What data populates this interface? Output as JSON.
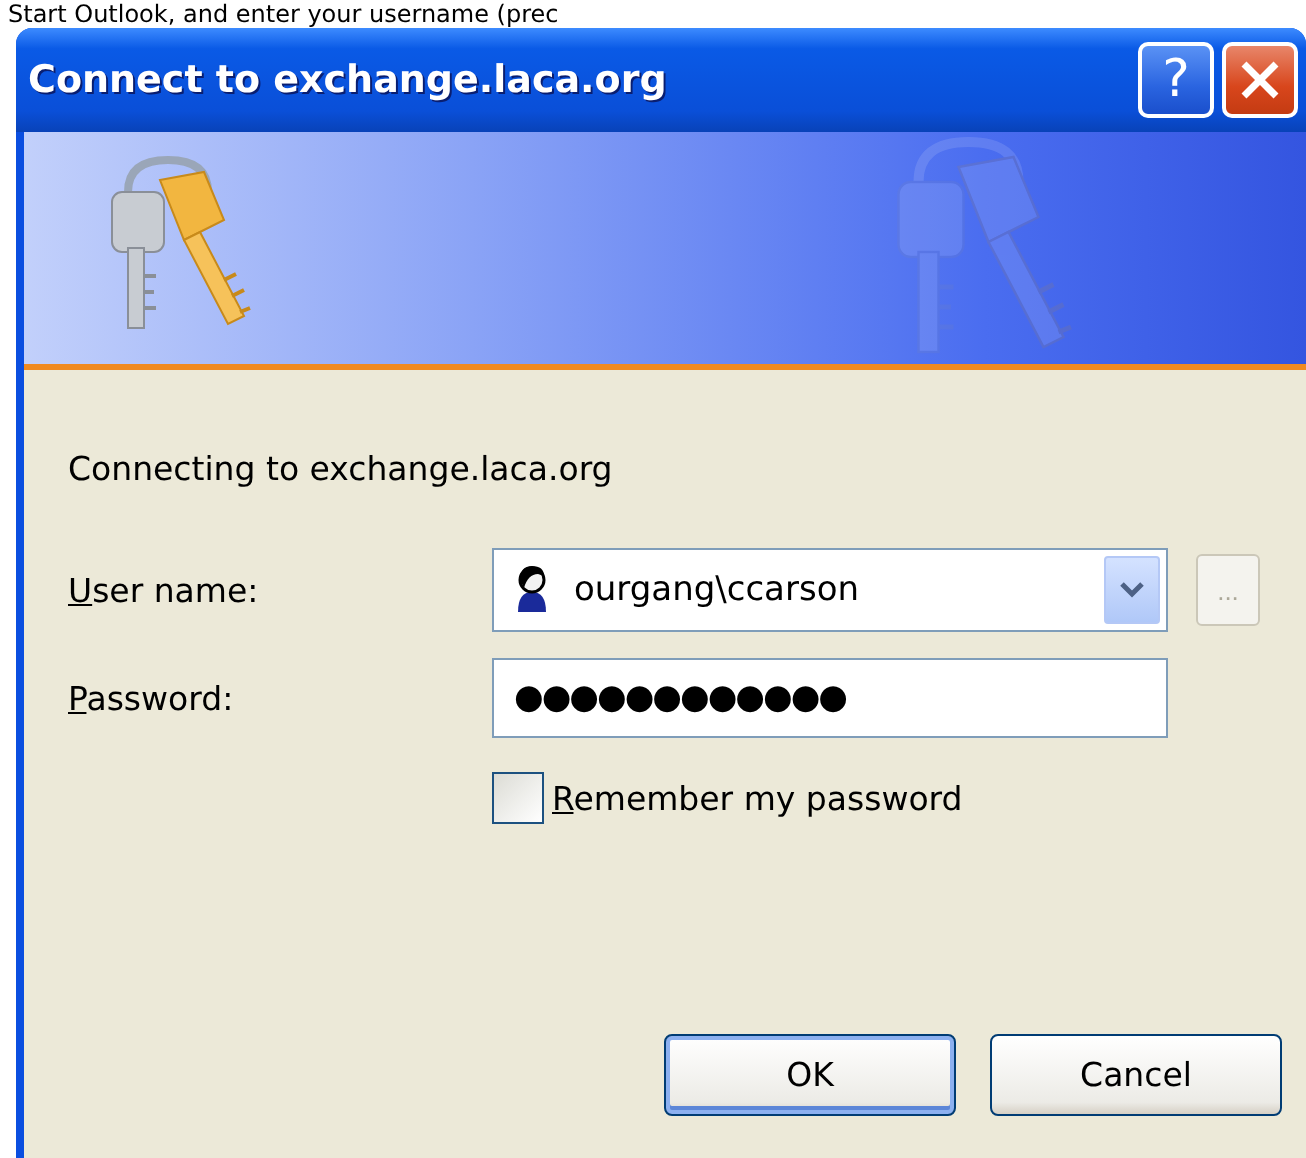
{
  "page_heading": "Start Outlook, and enter your username (prec",
  "window": {
    "title": "Connect to exchange.laca.org",
    "help_label": "?"
  },
  "message": "Connecting to exchange.laca.org",
  "fields": [
    {
      "kind": "combo",
      "label": "User name:",
      "value": "ourgang\\ccarson"
    },
    {
      "kind": "password",
      "label": "Password:",
      "value": "●●●●●●●●●●●●"
    }
  ],
  "browse_button": {
    "label": "...",
    "disabled": true
  },
  "checkbox": {
    "label": "Remember my password",
    "checked": false
  },
  "buttons": [
    {
      "label": "OK",
      "default": true
    },
    {
      "label": "Cancel",
      "default": false
    }
  ]
}
